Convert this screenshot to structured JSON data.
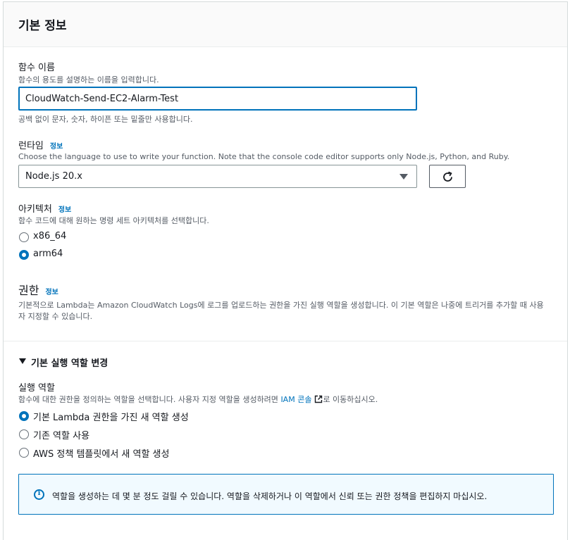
{
  "panel": {
    "title": "기본 정보"
  },
  "function_name": {
    "label": "함수 이름",
    "description": "함수의 용도를 설명하는 이름을 입력합니다.",
    "value": "CloudWatch-Send-EC2-Alarm-Test",
    "hint": "공백 없이 문자, 숫자, 하이픈 또는 밑줄만 사용합니다."
  },
  "runtime": {
    "label": "런타임",
    "info": "정보",
    "description": "Choose the language to use to write your function. Note that the console code editor supports only Node.js, Python, and Ruby.",
    "selected": "Node.js 20.x"
  },
  "architecture": {
    "label": "아키텍처",
    "info": "정보",
    "description": "함수 코드에 대해 원하는 명령 세트 아키텍처를 선택합니다.",
    "options": [
      {
        "label": "x86_64",
        "checked": false
      },
      {
        "label": "arm64",
        "checked": true
      }
    ]
  },
  "permissions": {
    "title": "권한",
    "info": "정보",
    "description_line1": "기본적으로 Lambda는 Amazon CloudWatch Logs에 로그를 업로드하는 권한을 가진 실행 역할을 생성합니다. 이 기본 역할은 나중에 트리거를 추가할 때 사용",
    "description_line2": "자 지정할 수 있습니다."
  },
  "execution_role": {
    "expander_label": "기본 실행 역할 변경",
    "label": "실행 역할",
    "description_prefix": "함수에 대한 권한을 정의하는 역할을 선택합니다. 사용자 지정 역할을 생성하려면",
    "description_link": "IAM 콘솔",
    "description_suffix": "로 이동하십시오.",
    "options": [
      {
        "label": "기본 Lambda 권한을 가진 새 역할 생성",
        "checked": true
      },
      {
        "label": "기존 역할 사용",
        "checked": false
      },
      {
        "label": "AWS 정책 템플릿에서 새 역할 생성",
        "checked": false
      }
    ],
    "notice": "역할을 생성하는 데 몇 분 정도 걸릴 수 있습니다. 역할을 삭제하거나 이 역할에서 신뢰 또는 권한 정책을 편집하지 마십시오."
  },
  "icons": {
    "refresh": "refresh-icon",
    "select_caret": "caret-down-icon",
    "expander": "caret-down-icon",
    "info": "info-circle-icon",
    "external": "external-link-icon"
  },
  "colors": {
    "accent": "#0073bb",
    "info_bg": "#f1faff",
    "text": "#16191f",
    "muted": "#545b64"
  }
}
